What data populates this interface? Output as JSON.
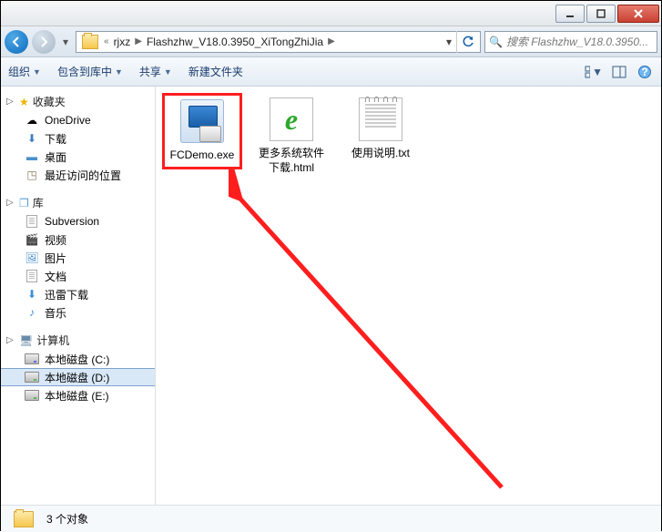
{
  "breadcrumb": {
    "sep_first": "«",
    "parent": "rjxz",
    "sep": "▶",
    "current": "Flashzhw_V18.0.3950_XiTongZhiJia"
  },
  "search": {
    "placeholder": "搜索 Flashzhw_V18.0.3950..."
  },
  "toolbar": {
    "organize": "组织",
    "include": "包含到库中",
    "share": "共享",
    "newfolder": "新建文件夹"
  },
  "sidebar": {
    "favorites": "收藏夹",
    "fav_items": [
      {
        "label": "OneDrive"
      },
      {
        "label": "下载"
      },
      {
        "label": "桌面"
      },
      {
        "label": "最近访问的位置"
      }
    ],
    "libraries": "库",
    "lib_items": [
      {
        "label": "Subversion"
      },
      {
        "label": "视频"
      },
      {
        "label": "图片"
      },
      {
        "label": "文档"
      },
      {
        "label": "迅雷下载"
      },
      {
        "label": "音乐"
      }
    ],
    "computer": "计算机",
    "drives": [
      {
        "label": "本地磁盘 (C:)"
      },
      {
        "label": "本地磁盘 (D:)"
      },
      {
        "label": "本地磁盘 (E:)"
      }
    ]
  },
  "files": [
    {
      "name": "FCDemo.exe"
    },
    {
      "name": "更多系统软件下载.html"
    },
    {
      "name": "使用说明.txt"
    }
  ],
  "status": {
    "count": "3 个对象"
  }
}
